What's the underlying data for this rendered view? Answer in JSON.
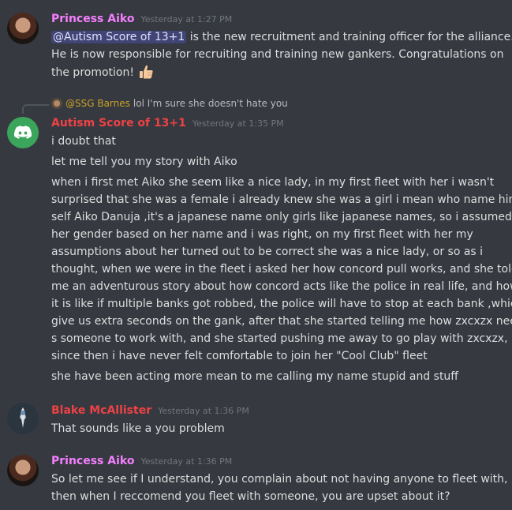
{
  "messages": [
    {
      "author": "Princess Aiko",
      "author_color": "#f47fff",
      "timestamp": "Yesterday at 1:27 PM",
      "mention": "@Autism Score of 13+1",
      "lines": [
        " is the new recruitment and training officer for the alliance.",
        "He is now responsible for recruiting and training new gankers. Congratulations on",
        "the promotion!"
      ],
      "emoji": "thumbs-up"
    },
    {
      "reply": {
        "author": "@SSG Barnes",
        "author_color": "#c9a227",
        "text": "lol I'm sure she doesn't hate you"
      },
      "author": "Autism Score of 13+1",
      "author_color": "#ed4245",
      "timestamp": "Yesterday at 1:35 PM",
      "line1": "i doubt that",
      "line2": "let me tell you my story with Aiko",
      "paragraph": [
        "when i first met Aiko she seem like a nice lady, in my first fleet with her i wasn't",
        "surprised that she was a female i already knew she was a girl i mean who name him",
        "self Aiko Danuja ,it's a japanese name only girls like japanese names, so i assumed",
        "her gender based on her name and i was right, on my first fleet with her my",
        "assumptions about her turned out to be correct she was a nice lady, or so as i",
        "thought, when we were in the fleet i asked her how concord pull works, and she told",
        "me an adventurous story about how concord acts like the police in real life, and how",
        "it is like if multiple banks got robbed, the police will have to stop at each bank ,which",
        "give us extra seconds on the gank, after that she started telling me how  zxcxzx need",
        "s someone to work with, and she started pushing me away to go play with  zxcxzx,",
        "since then i have never felt comfortable to join her \"Cool Club\" fleet"
      ],
      "line_last": "she have been acting more mean to me calling my name stupid and stuff"
    },
    {
      "author": "Blake McAllister",
      "author_color": "#ed4245",
      "timestamp": "Yesterday at 1:36 PM",
      "line1": "That sounds like a you problem"
    },
    {
      "author": "Princess Aiko",
      "author_color": "#f47fff",
      "timestamp": "Yesterday at 1:36 PM",
      "lines": [
        "So let me see if I understand, you complain about not having anyone to fleet with, but",
        "then when I reccomend you fleet with someone, you are upset about it?"
      ]
    }
  ]
}
